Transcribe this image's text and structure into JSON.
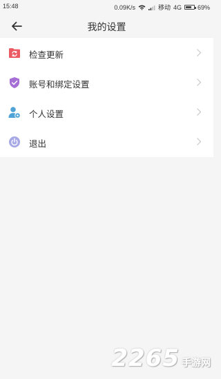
{
  "status_bar": {
    "time": "15:48",
    "speed": "0.09K/s",
    "carrier": "移动",
    "network": "4G",
    "battery_text": "69%",
    "battery_level": 0.69
  },
  "nav": {
    "title": "我的设置",
    "back_icon": "arrow-left-icon"
  },
  "menu": {
    "items": [
      {
        "label": "检查更新",
        "icon": "refresh-icon",
        "color": "#ec5a63"
      },
      {
        "label": "账号和绑定设置",
        "icon": "shield-icon",
        "color": "#a56fd6"
      },
      {
        "label": "个人设置",
        "icon": "user-settings-icon",
        "color": "#4fa3d6"
      },
      {
        "label": "退出",
        "icon": "power-icon",
        "color": "#a7a9e6"
      }
    ],
    "chevron_icon": "chevron-right-icon"
  },
  "watermark": {
    "number": "2265",
    "text": "手游网"
  }
}
